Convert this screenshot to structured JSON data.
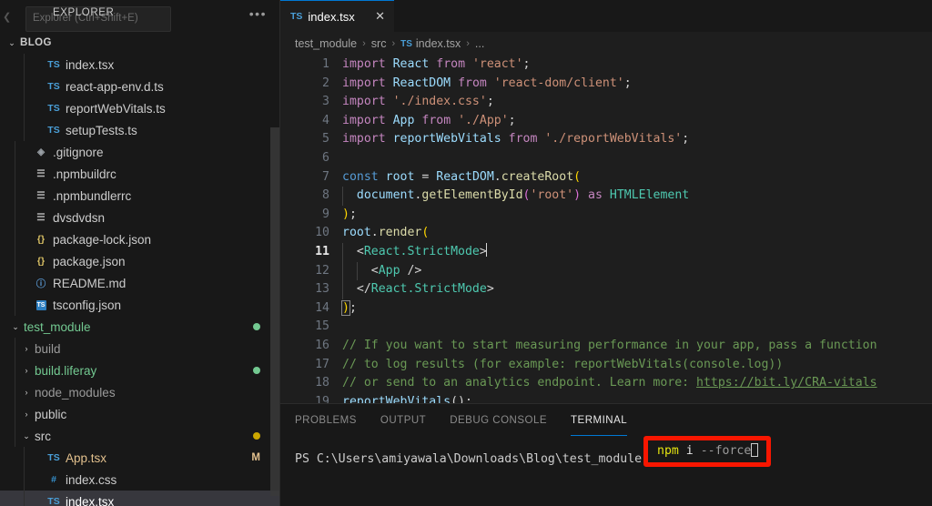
{
  "sidebar": {
    "title": "EXPLORER",
    "tooltip_text": "Explorer (Ctrl+Shift+E)",
    "actions_icon": "•••",
    "collapse_icon": "❮",
    "root": {
      "label": "BLOG",
      "twisty": "⌄"
    },
    "items": [
      {
        "label": "index.tsx",
        "icon": "TS",
        "icon_class": "ico-ts",
        "indent": 36,
        "twisty": "",
        "badge": "",
        "dot": "",
        "kind": "file",
        "selected": false,
        "color": "#cccccc"
      },
      {
        "label": "react-app-env.d.ts",
        "icon": "TS",
        "icon_class": "ico-ts",
        "indent": 36,
        "twisty": "",
        "badge": "",
        "dot": "",
        "kind": "file",
        "selected": false,
        "color": "#cccccc"
      },
      {
        "label": "reportWebVitals.ts",
        "icon": "TS",
        "icon_class": "ico-ts",
        "indent": 36,
        "twisty": "",
        "badge": "",
        "dot": "",
        "kind": "file",
        "selected": false,
        "color": "#cccccc"
      },
      {
        "label": "setupTests.ts",
        "icon": "TS",
        "icon_class": "ico-ts",
        "indent": 36,
        "twisty": "",
        "badge": "",
        "dot": "",
        "kind": "file",
        "selected": false,
        "color": "#cccccc"
      },
      {
        "label": ".gitignore",
        "icon": "◈",
        "icon_class": "ico-git",
        "indent": 22,
        "twisty": "",
        "badge": "",
        "dot": "",
        "kind": "file",
        "selected": false,
        "color": "#cccccc"
      },
      {
        "label": ".npmbuildrc",
        "icon": "☰",
        "icon_class": "ico-cfg",
        "indent": 22,
        "twisty": "",
        "badge": "",
        "dot": "",
        "kind": "file",
        "selected": false,
        "color": "#cccccc"
      },
      {
        "label": ".npmbundlerrc",
        "icon": "☰",
        "icon_class": "ico-cfg",
        "indent": 22,
        "twisty": "",
        "badge": "",
        "dot": "",
        "kind": "file",
        "selected": false,
        "color": "#cccccc"
      },
      {
        "label": "dvsdvdsn",
        "icon": "☰",
        "icon_class": "ico-cfg",
        "indent": 22,
        "twisty": "",
        "badge": "",
        "dot": "",
        "kind": "file",
        "selected": false,
        "color": "#cccccc"
      },
      {
        "label": "package-lock.json",
        "icon": "{}",
        "icon_class": "ico-json",
        "indent": 22,
        "twisty": "",
        "badge": "",
        "dot": "",
        "kind": "file",
        "selected": false,
        "color": "#cccccc"
      },
      {
        "label": "package.json",
        "icon": "{}",
        "icon_class": "ico-json",
        "indent": 22,
        "twisty": "",
        "badge": "",
        "dot": "",
        "kind": "file",
        "selected": false,
        "color": "#cccccc"
      },
      {
        "label": "README.md",
        "icon": "ⓘ",
        "icon_class": "ico-md",
        "indent": 22,
        "twisty": "",
        "badge": "",
        "dot": "",
        "kind": "file",
        "selected": false,
        "color": "#cccccc"
      },
      {
        "label": "tsconfig.json",
        "icon": "TS",
        "icon_class": "ico-tsconf",
        "indent": 22,
        "twisty": "",
        "badge": "",
        "dot": "",
        "kind": "file",
        "selected": false,
        "color": "#cccccc"
      },
      {
        "label": "test_module",
        "icon": "",
        "icon_class": "",
        "indent": 10,
        "twisty": "⌄",
        "badge": "",
        "dot": "#73c991",
        "kind": "folder",
        "selected": false,
        "color": "#73c991"
      },
      {
        "label": "build",
        "icon": "",
        "icon_class": "",
        "indent": 22,
        "twisty": "›",
        "badge": "",
        "dot": "",
        "kind": "folder",
        "selected": false,
        "color": "#9a9a9a"
      },
      {
        "label": "build.liferay",
        "icon": "",
        "icon_class": "",
        "indent": 22,
        "twisty": "›",
        "badge": "",
        "dot": "#73c991",
        "kind": "folder",
        "selected": false,
        "color": "#73c991"
      },
      {
        "label": "node_modules",
        "icon": "",
        "icon_class": "",
        "indent": 22,
        "twisty": "›",
        "badge": "",
        "dot": "",
        "kind": "folder",
        "selected": false,
        "color": "#9a9a9a"
      },
      {
        "label": "public",
        "icon": "",
        "icon_class": "",
        "indent": 22,
        "twisty": "›",
        "badge": "",
        "dot": "",
        "kind": "folder",
        "selected": false,
        "color": "#cccccc"
      },
      {
        "label": "src",
        "icon": "",
        "icon_class": "",
        "indent": 22,
        "twisty": "⌄",
        "badge": "",
        "dot": "#cca700",
        "kind": "folder",
        "selected": false,
        "color": "#cccccc"
      },
      {
        "label": "App.tsx",
        "icon": "TS",
        "icon_class": "ico-ts",
        "indent": 36,
        "twisty": "",
        "badge": "M",
        "dot": "",
        "kind": "file",
        "selected": false,
        "color": "#e2c08d"
      },
      {
        "label": "index.css",
        "icon": "#",
        "icon_class": "ico-css",
        "indent": 36,
        "twisty": "",
        "badge": "",
        "dot": "",
        "kind": "file",
        "selected": false,
        "color": "#cccccc"
      },
      {
        "label": "index.tsx",
        "icon": "TS",
        "icon_class": "ico-ts",
        "indent": 36,
        "twisty": "",
        "badge": "",
        "dot": "",
        "kind": "file",
        "selected": true,
        "color": "#ffffff"
      }
    ]
  },
  "editor": {
    "tab": {
      "label": "index.tsx",
      "icon": "TS",
      "close_icon": "✕",
      "active": true
    },
    "breadcrumb": {
      "parts": [
        "test_module",
        "src",
        "index.tsx",
        "..."
      ],
      "file_icon": "TS",
      "separator": "›"
    },
    "active_line": 11,
    "lines": [
      {
        "n": 1,
        "tokens": [
          {
            "t": "import",
            "c": "kw"
          },
          {
            "t": " ",
            "c": "pn"
          },
          {
            "t": "React",
            "c": "var"
          },
          {
            "t": " ",
            "c": "pn"
          },
          {
            "t": "from",
            "c": "kw"
          },
          {
            "t": " ",
            "c": "pn"
          },
          {
            "t": "'react'",
            "c": "str"
          },
          {
            "t": ";",
            "c": "pn"
          }
        ]
      },
      {
        "n": 2,
        "tokens": [
          {
            "t": "import",
            "c": "kw"
          },
          {
            "t": " ",
            "c": "pn"
          },
          {
            "t": "ReactDOM",
            "c": "var"
          },
          {
            "t": " ",
            "c": "pn"
          },
          {
            "t": "from",
            "c": "kw"
          },
          {
            "t": " ",
            "c": "pn"
          },
          {
            "t": "'react-dom/client'",
            "c": "str"
          },
          {
            "t": ";",
            "c": "pn"
          }
        ]
      },
      {
        "n": 3,
        "tokens": [
          {
            "t": "import",
            "c": "kw"
          },
          {
            "t": " ",
            "c": "pn"
          },
          {
            "t": "'./index.css'",
            "c": "str"
          },
          {
            "t": ";",
            "c": "pn"
          }
        ]
      },
      {
        "n": 4,
        "tokens": [
          {
            "t": "import",
            "c": "kw"
          },
          {
            "t": " ",
            "c": "pn"
          },
          {
            "t": "App",
            "c": "var"
          },
          {
            "t": " ",
            "c": "pn"
          },
          {
            "t": "from",
            "c": "kw"
          },
          {
            "t": " ",
            "c": "pn"
          },
          {
            "t": "'./App'",
            "c": "str"
          },
          {
            "t": ";",
            "c": "pn"
          }
        ]
      },
      {
        "n": 5,
        "tokens": [
          {
            "t": "import",
            "c": "kw"
          },
          {
            "t": " ",
            "c": "pn"
          },
          {
            "t": "reportWebVitals",
            "c": "var"
          },
          {
            "t": " ",
            "c": "pn"
          },
          {
            "t": "from",
            "c": "kw"
          },
          {
            "t": " ",
            "c": "pn"
          },
          {
            "t": "'./reportWebVitals'",
            "c": "str"
          },
          {
            "t": ";",
            "c": "pn"
          }
        ]
      },
      {
        "n": 6,
        "tokens": []
      },
      {
        "n": 7,
        "tokens": [
          {
            "t": "const",
            "c": "kw2"
          },
          {
            "t": " ",
            "c": "pn"
          },
          {
            "t": "root",
            "c": "var"
          },
          {
            "t": " = ",
            "c": "pn"
          },
          {
            "t": "ReactDOM",
            "c": "var"
          },
          {
            "t": ".",
            "c": "pn"
          },
          {
            "t": "createRoot",
            "c": "fn"
          },
          {
            "t": "(",
            "c": "b1"
          }
        ]
      },
      {
        "n": 8,
        "tokens": [
          {
            "t": "  ",
            "c": "pn"
          },
          {
            "t": "document",
            "c": "var"
          },
          {
            "t": ".",
            "c": "pn"
          },
          {
            "t": "getElementById",
            "c": "fn"
          },
          {
            "t": "(",
            "c": "b2"
          },
          {
            "t": "'root'",
            "c": "str"
          },
          {
            "t": ")",
            "c": "b2"
          },
          {
            "t": " ",
            "c": "pn"
          },
          {
            "t": "as",
            "c": "kw"
          },
          {
            "t": " ",
            "c": "pn"
          },
          {
            "t": "HTMLElement",
            "c": "cls"
          }
        ]
      },
      {
        "n": 9,
        "tokens": [
          {
            "t": ")",
            "c": "b1"
          },
          {
            "t": ";",
            "c": "pn"
          }
        ]
      },
      {
        "n": 10,
        "tokens": [
          {
            "t": "root",
            "c": "var"
          },
          {
            "t": ".",
            "c": "pn"
          },
          {
            "t": "render",
            "c": "fn"
          },
          {
            "t": "(",
            "c": "b1"
          }
        ]
      },
      {
        "n": 11,
        "tokens": [
          {
            "t": "  ",
            "c": "pn"
          },
          {
            "t": "<",
            "c": "pn"
          },
          {
            "t": "React.StrictMode",
            "c": "cls"
          },
          {
            "t": ">",
            "c": "pn"
          }
        ]
      },
      {
        "n": 12,
        "tokens": [
          {
            "t": "    ",
            "c": "pn"
          },
          {
            "t": "<",
            "c": "pn"
          },
          {
            "t": "App",
            "c": "cls"
          },
          {
            "t": " />",
            "c": "pn"
          }
        ]
      },
      {
        "n": 13,
        "tokens": [
          {
            "t": "  ",
            "c": "pn"
          },
          {
            "t": "</",
            "c": "pn"
          },
          {
            "t": "React.StrictMode",
            "c": "cls"
          },
          {
            "t": ">",
            "c": "pn"
          }
        ]
      },
      {
        "n": 14,
        "tokens": [
          {
            "t": ")",
            "c": "b1"
          },
          {
            "t": ";",
            "c": "pn"
          }
        ]
      },
      {
        "n": 15,
        "tokens": []
      },
      {
        "n": 16,
        "tokens": [
          {
            "t": "// If you want to start measuring performance in your app, pass a function",
            "c": "cmt"
          }
        ]
      },
      {
        "n": 17,
        "tokens": [
          {
            "t": "// to log results (for example: reportWebVitals(console.log))",
            "c": "cmt"
          }
        ]
      },
      {
        "n": 18,
        "tokens": [
          {
            "t": "// or send to an analytics endpoint. Learn more: ",
            "c": "cmt"
          },
          {
            "t": "https://bit.ly/CRA-vitals",
            "c": "lnk"
          }
        ]
      },
      {
        "n": 19,
        "tokens": [
          {
            "t": "reportWebVitals",
            "c": "var"
          },
          {
            "t": "();",
            "c": "pn"
          }
        ]
      }
    ]
  },
  "panel": {
    "tabs": [
      {
        "label": "PROBLEMS",
        "active": false
      },
      {
        "label": "OUTPUT",
        "active": false
      },
      {
        "label": "DEBUG CONSOLE",
        "active": false
      },
      {
        "label": "TERMINAL",
        "active": true
      }
    ],
    "terminal": {
      "prompt": "PS C:\\Users\\amiyawala\\Downloads\\Blog\\test_module",
      "command_parts": [
        {
          "text": "npm",
          "class": "t-yellow"
        },
        {
          "text": " ",
          "class": "t-white"
        },
        {
          "text": "i",
          "class": "t-white"
        },
        {
          "text": " ",
          "class": "t-white"
        },
        {
          "text": "--force",
          "class": "t-grey"
        }
      ],
      "full_command": "npm i --force",
      "highlight_color": "#f81600",
      "cursor_visible": true
    }
  }
}
